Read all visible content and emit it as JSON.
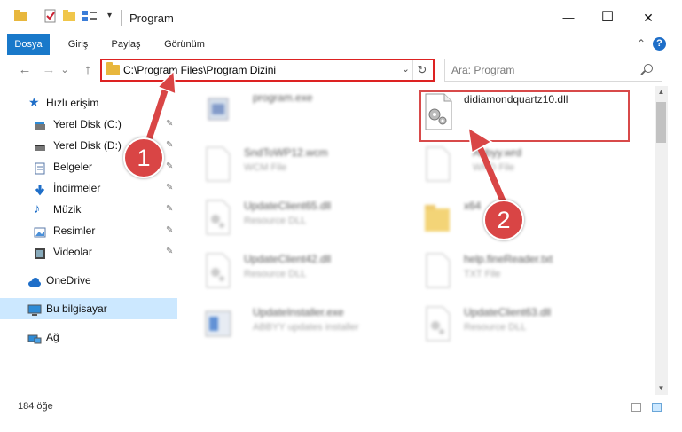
{
  "window": {
    "title": "Program",
    "minimize_glyph": "—",
    "maximize_glyph": "☐",
    "close_glyph": "✕"
  },
  "ribbon": {
    "tabs": [
      "Dosya",
      "Giriş",
      "Paylaş",
      "Görünüm"
    ],
    "help_glyph": "?",
    "collapse_glyph": "⌃"
  },
  "nav": {
    "back_glyph": "←",
    "forward_glyph": "→",
    "recent_glyph": "⌄",
    "up_glyph": "↑",
    "address": "C:\\Program Files\\Program Dizini",
    "address_dropdown_glyph": "⌄",
    "refresh_glyph": "↻",
    "search_placeholder": "Ara: Program"
  },
  "sidebar": {
    "quick_access": "Hızlı erişim",
    "items": [
      {
        "label": "Yerel Disk (C:)",
        "icon": "drive-icon"
      },
      {
        "label": "Yerel Disk (D:)",
        "icon": "drive-icon"
      },
      {
        "label": "Belgeler",
        "icon": "documents-icon"
      },
      {
        "label": "İndirmeler",
        "icon": "download-icon"
      },
      {
        "label": "Müzik",
        "icon": "music-icon"
      },
      {
        "label": "Resimler",
        "icon": "pictures-icon"
      },
      {
        "label": "Videolar",
        "icon": "videos-icon"
      }
    ],
    "onedrive": "OneDrive",
    "this_pc": "Bu bilgisayar",
    "network": "Ağ",
    "pin_glyph": "📌"
  },
  "files": [
    {
      "name": "program.exe",
      "type": ""
    },
    {
      "name": "didiamondquartz10.dll",
      "type": ""
    },
    {
      "name": "SndToWP12.wcm",
      "type": "WCM File"
    },
    {
      "name": "Abbyy.wrd",
      "type": "WRD File"
    },
    {
      "name": "UpdateClient65.dll",
      "type": "Resource DLL"
    },
    {
      "name": "x64",
      "type": ""
    },
    {
      "name": "UpdateClient42.dll",
      "type": "Resource DLL"
    },
    {
      "name": "help.fineReader.txt",
      "type": "TXT File"
    },
    {
      "name": "UpdateInstaller.exe",
      "type": "ABBYY updates installer"
    },
    {
      "name": "UpdateClient63.dll",
      "type": "Resource DLL"
    }
  ],
  "annotations": {
    "badge_1": "1",
    "badge_2": "2",
    "accent": "#d94545"
  },
  "status": {
    "count": "184 öğe"
  },
  "scrollbar": {
    "up_glyph": "▲",
    "down_glyph": "▼"
  }
}
